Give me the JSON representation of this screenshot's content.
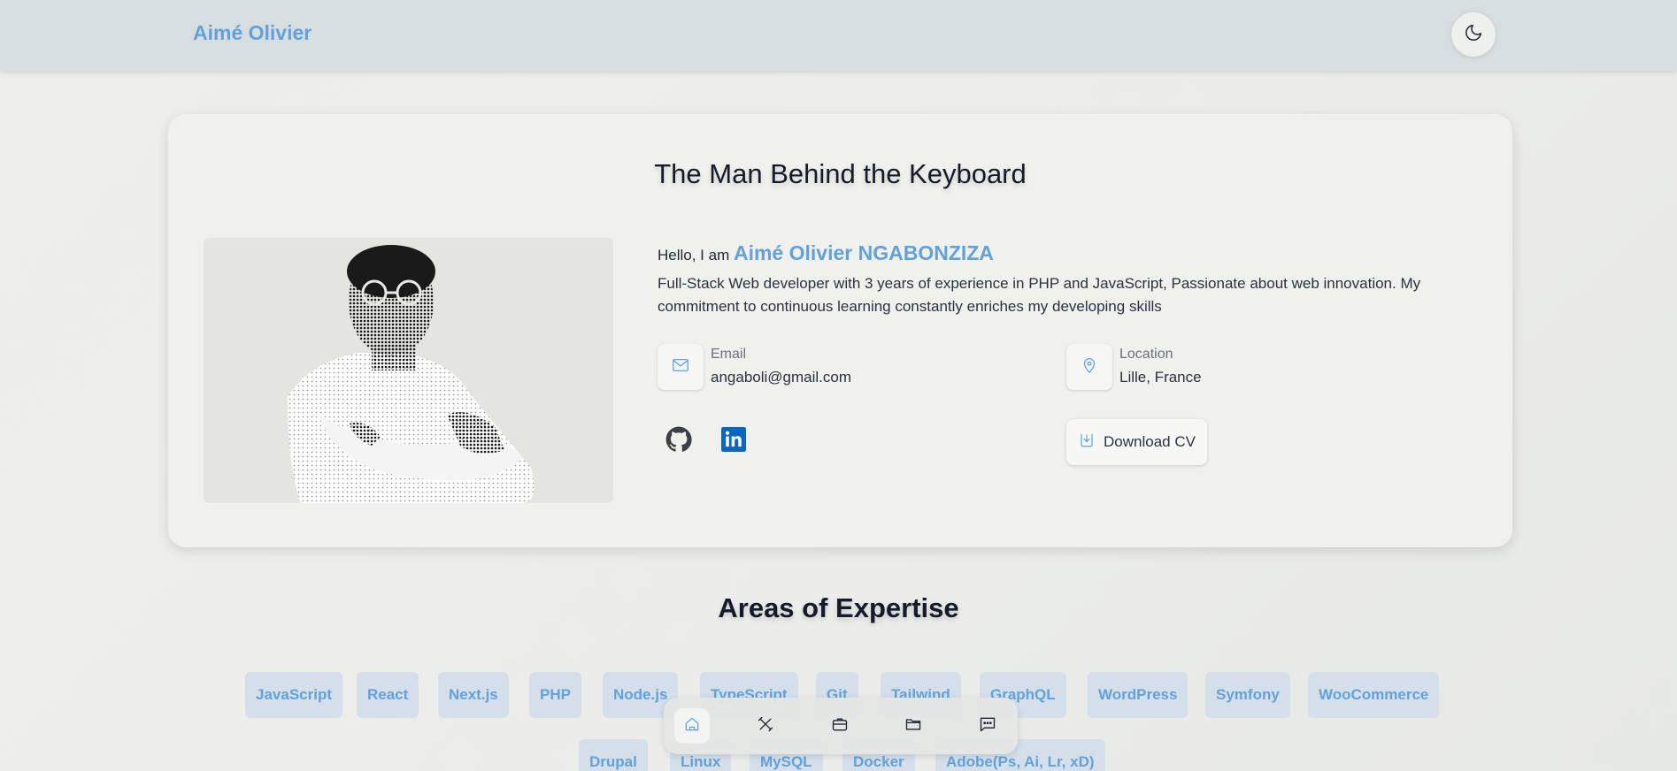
{
  "header": {
    "brand": "Aimé Olivier",
    "theme_toggle_icon": "moon-icon"
  },
  "about": {
    "title": "The Man Behind the Keyboard",
    "greeting": "Hello, I am",
    "name": "Aimé Olivier NGABONZIZA",
    "bio": "Full-Stack Web developer with 3 years of experience in PHP and JavaScript, Passionate about web innovation. My commitment to continuous learning constantly enriches my developing skills",
    "email": {
      "label": "Email",
      "value": "angaboli@gmail.com",
      "icon": "mail-icon"
    },
    "location": {
      "label": "Location",
      "value": "Lille, France",
      "icon": "map-pin-icon"
    },
    "socials": [
      {
        "name": "GitHub",
        "icon": "github-icon"
      },
      {
        "name": "LinkedIn",
        "icon": "linkedin-icon"
      }
    ],
    "download_cv": "Download CV"
  },
  "expertise": {
    "title": "Areas of Expertise",
    "skills": [
      "JavaScript",
      "React",
      "Next.js",
      "PHP",
      "Node.js",
      "TypeScript",
      "Git",
      "Tailwind",
      "GraphQL",
      "WordPress",
      "Symfony",
      "WooCommerce",
      "Drupal",
      "Linux",
      "MySQL",
      "Docker",
      "Adobe(Ps, Ai, Lr, xD)"
    ]
  },
  "dock": {
    "items": [
      {
        "name": "home",
        "icon": "home-icon",
        "active": true
      },
      {
        "name": "skills",
        "icon": "tools-icon",
        "active": false
      },
      {
        "name": "experience",
        "icon": "briefcase-icon",
        "active": false
      },
      {
        "name": "projects",
        "icon": "folder-icon",
        "active": false
      },
      {
        "name": "contact",
        "icon": "message-icon",
        "active": false
      }
    ]
  },
  "colors": {
    "accent": "#62a1dc",
    "header_bg": "#d6dedf",
    "chip_bg": "#d4dfea",
    "linkedin": "#0a66c2"
  }
}
